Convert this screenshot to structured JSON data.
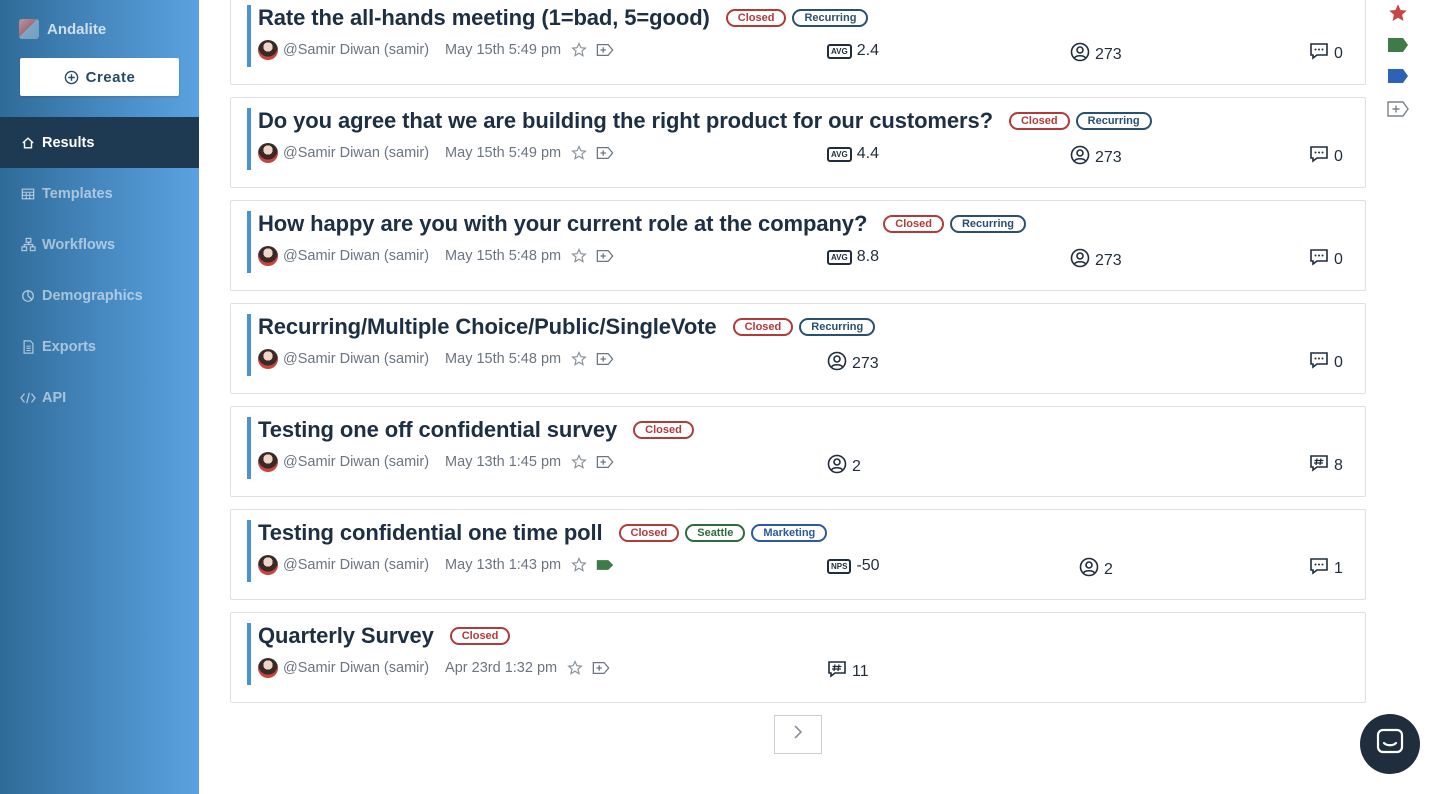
{
  "brand": {
    "name": "Andalite"
  },
  "sidebar": {
    "create_label": "Create",
    "items": [
      {
        "label": "Results",
        "icon": "home-icon",
        "active": true
      },
      {
        "label": "Templates",
        "icon": "table-icon",
        "active": false
      },
      {
        "label": "Workflows",
        "icon": "workflow-icon",
        "active": false
      },
      {
        "label": "Demographics",
        "icon": "pie-icon",
        "active": false
      },
      {
        "label": "Exports",
        "icon": "document-icon",
        "active": false
      },
      {
        "label": "API",
        "icon": "code-icon",
        "active": false
      }
    ]
  },
  "surveys": [
    {
      "title": "Rate the all-hands meeting (1=bad, 5=good)",
      "tags": [
        "Closed",
        "Recurring"
      ],
      "author": "@Samir Diwan (samir)",
      "date": "May 15th 5:49 pm",
      "metric_type": "AVG",
      "metric_value": "2.4",
      "respondents": "273",
      "comments": "0"
    },
    {
      "title": "Do you agree that we are building the right product for our customers?",
      "tags": [
        "Closed",
        "Recurring"
      ],
      "author": "@Samir Diwan (samir)",
      "date": "May 15th 5:49 pm",
      "metric_type": "AVG",
      "metric_value": "4.4",
      "respondents": "273",
      "comments": "0"
    },
    {
      "title": "How happy are you with your current role at the company?",
      "tags": [
        "Closed",
        "Recurring"
      ],
      "author": "@Samir Diwan (samir)",
      "date": "May 15th 5:48 pm",
      "metric_type": "AVG",
      "metric_value": "8.8",
      "respondents": "273",
      "comments": "0"
    },
    {
      "title": "Recurring/Multiple Choice/Public/SingleVote",
      "tags": [
        "Closed",
        "Recurring"
      ],
      "author": "@Samir Diwan (samir)",
      "date": "May 15th 5:48 pm",
      "respondents": "273",
      "comments": "0"
    },
    {
      "title": "Testing one off confidential survey",
      "tags": [
        "Closed"
      ],
      "author": "@Samir Diwan (samir)",
      "date": "May 13th 1:45 pm",
      "respondents": "2",
      "hash_comments": "8"
    },
    {
      "title": "Testing confidential one time poll",
      "tags": [
        "Closed",
        "Seattle",
        "Marketing"
      ],
      "author": "@Samir Diwan (samir)",
      "date": "May 13th 1:43 pm",
      "metric_type": "NPS",
      "metric_value": "-50",
      "respondents": "2",
      "comments": "1"
    },
    {
      "title": "Quarterly Survey",
      "tags": [
        "Closed"
      ],
      "author": "@Samir Diwan (samir)",
      "date": "Apr 23rd 1:32 pm",
      "hash_comments": "11"
    }
  ],
  "colors": {
    "accent": "#4a93d2",
    "sidebar_active": "#1d3a52",
    "closed": "#b13a3a",
    "recurring": "#2a4f70"
  }
}
